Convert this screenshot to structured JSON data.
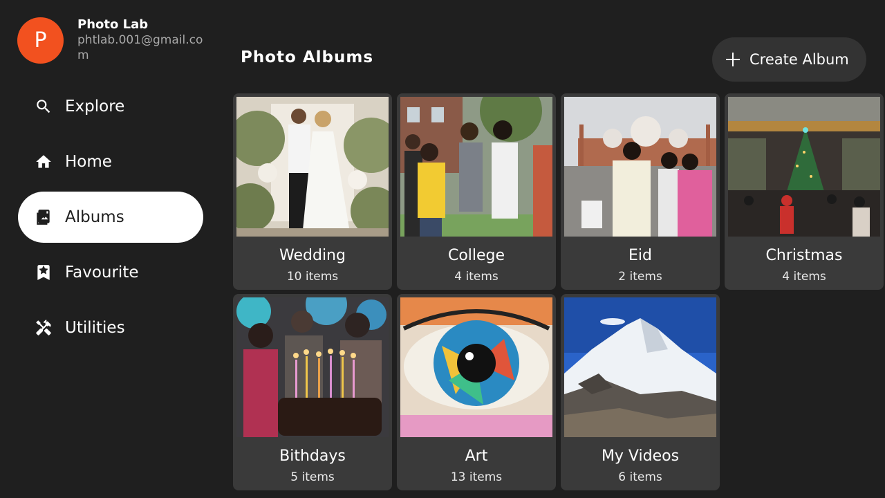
{
  "profile": {
    "initial": "P",
    "name": "Photo Lab",
    "email": "phtlab.001@gmail.com"
  },
  "nav": {
    "items": [
      {
        "label": "Explore",
        "icon": "search-icon"
      },
      {
        "label": "Home",
        "icon": "home-icon"
      },
      {
        "label": "Albums",
        "icon": "album-icon"
      },
      {
        "label": "Favourite",
        "icon": "bookmark-star-icon"
      },
      {
        "label": "Utilities",
        "icon": "tools-icon"
      }
    ],
    "active": "Albums"
  },
  "main": {
    "title": "Photo Albums",
    "create_label": "Create Album"
  },
  "albums": [
    {
      "title": "Wedding",
      "count": "10 items"
    },
    {
      "title": "College",
      "count": "4 items"
    },
    {
      "title": "Eid",
      "count": "2 items"
    },
    {
      "title": "Christmas",
      "count": "4 items"
    },
    {
      "title": "Bithdays",
      "count": "5 items"
    },
    {
      "title": "Art",
      "count": "13 items"
    },
    {
      "title": "My Videos",
      "count": "6 items"
    }
  ],
  "colors": {
    "background": "#1f1f1f",
    "avatar": "#f2511f",
    "card": "#3a3a3a",
    "active_nav": "#ffffff"
  }
}
